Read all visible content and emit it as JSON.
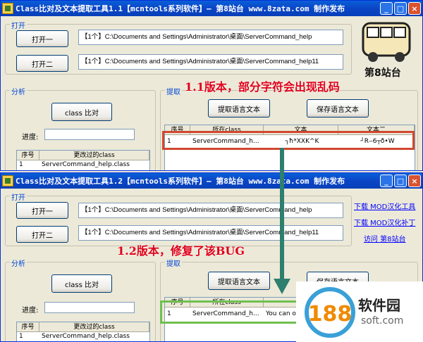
{
  "window1": {
    "title": "Class比对及文本提取工具1.1【mcntools系列软件】— 第8站台 www.8zata.com 制作发布",
    "open_group_label": "打开",
    "open1_label": "打开一",
    "open2_label": "打开二",
    "path1": "【1个】C:\\Documents and Settings\\Administrator\\桌面\\ServerCommand_help",
    "path2": "【1个】C:\\Documents and Settings\\Administrator\\桌面\\ServerCommand_help11",
    "analysis_group_label": "分析",
    "compare_label": "class 比对",
    "progress_label": "进度:",
    "extract_group_label": "提取",
    "extract_btn": "提取语言文本",
    "save_btn": "保存语言文本",
    "left_grid_headers": [
      "序号",
      "更改过的class"
    ],
    "left_grid_rows": [
      [
        "1",
        "ServerCommand_help.class"
      ]
    ],
    "right_grid_headers": [
      "序号",
      "所在class",
      "文本",
      "文本二"
    ],
    "right_grid_rows": [
      [
        "1",
        "ServerCommand_h...",
        "┐ħ*XXK^K",
        "┘R‒6┬ð•W"
      ]
    ],
    "site_label": "第8站台"
  },
  "window2": {
    "title": "Class比对及文本提取工具1.2【mcntools系列软件】— 第8站台 www.8zata.com 制作发布",
    "open_group_label": "打开",
    "open1_label": "打开一",
    "open2_label": "打开二",
    "path1": "【1个】C:\\Documents and Settings\\Administrator\\桌面\\ServerCommand_help",
    "path2": "【1个】C:\\Documents and Settings\\Administrator\\桌面\\ServerCommand_help11",
    "links": [
      "下载 MOD汉化工具",
      "下载 MOD汉化补丁",
      "访问 第8站台"
    ],
    "analysis_group_label": "分析",
    "compare_label": "class 比对",
    "progress_label": "进度:",
    "extract_group_label": "提取",
    "extract_btn": "提取语言文本",
    "save_btn": "保存语言文本",
    "left_grid_headers": [
      "序号",
      "更改过的class"
    ],
    "left_grid_rows": [
      [
        "1",
        "ServerCommand_help.class"
      ]
    ],
    "right_grid_headers": [
      "序号",
      "所在class",
      "文"
    ],
    "right_grid_rows": [
      [
        "1",
        "ServerCommand_h...",
        "You can or"
      ]
    ]
  },
  "annotations": {
    "v11": "1.1版本，部分字符会出现乱码",
    "v12": "1.2版本，修复了该BUG"
  },
  "watermark": {
    "text": "软件园",
    "domain": "soft.com",
    "number": "188"
  }
}
